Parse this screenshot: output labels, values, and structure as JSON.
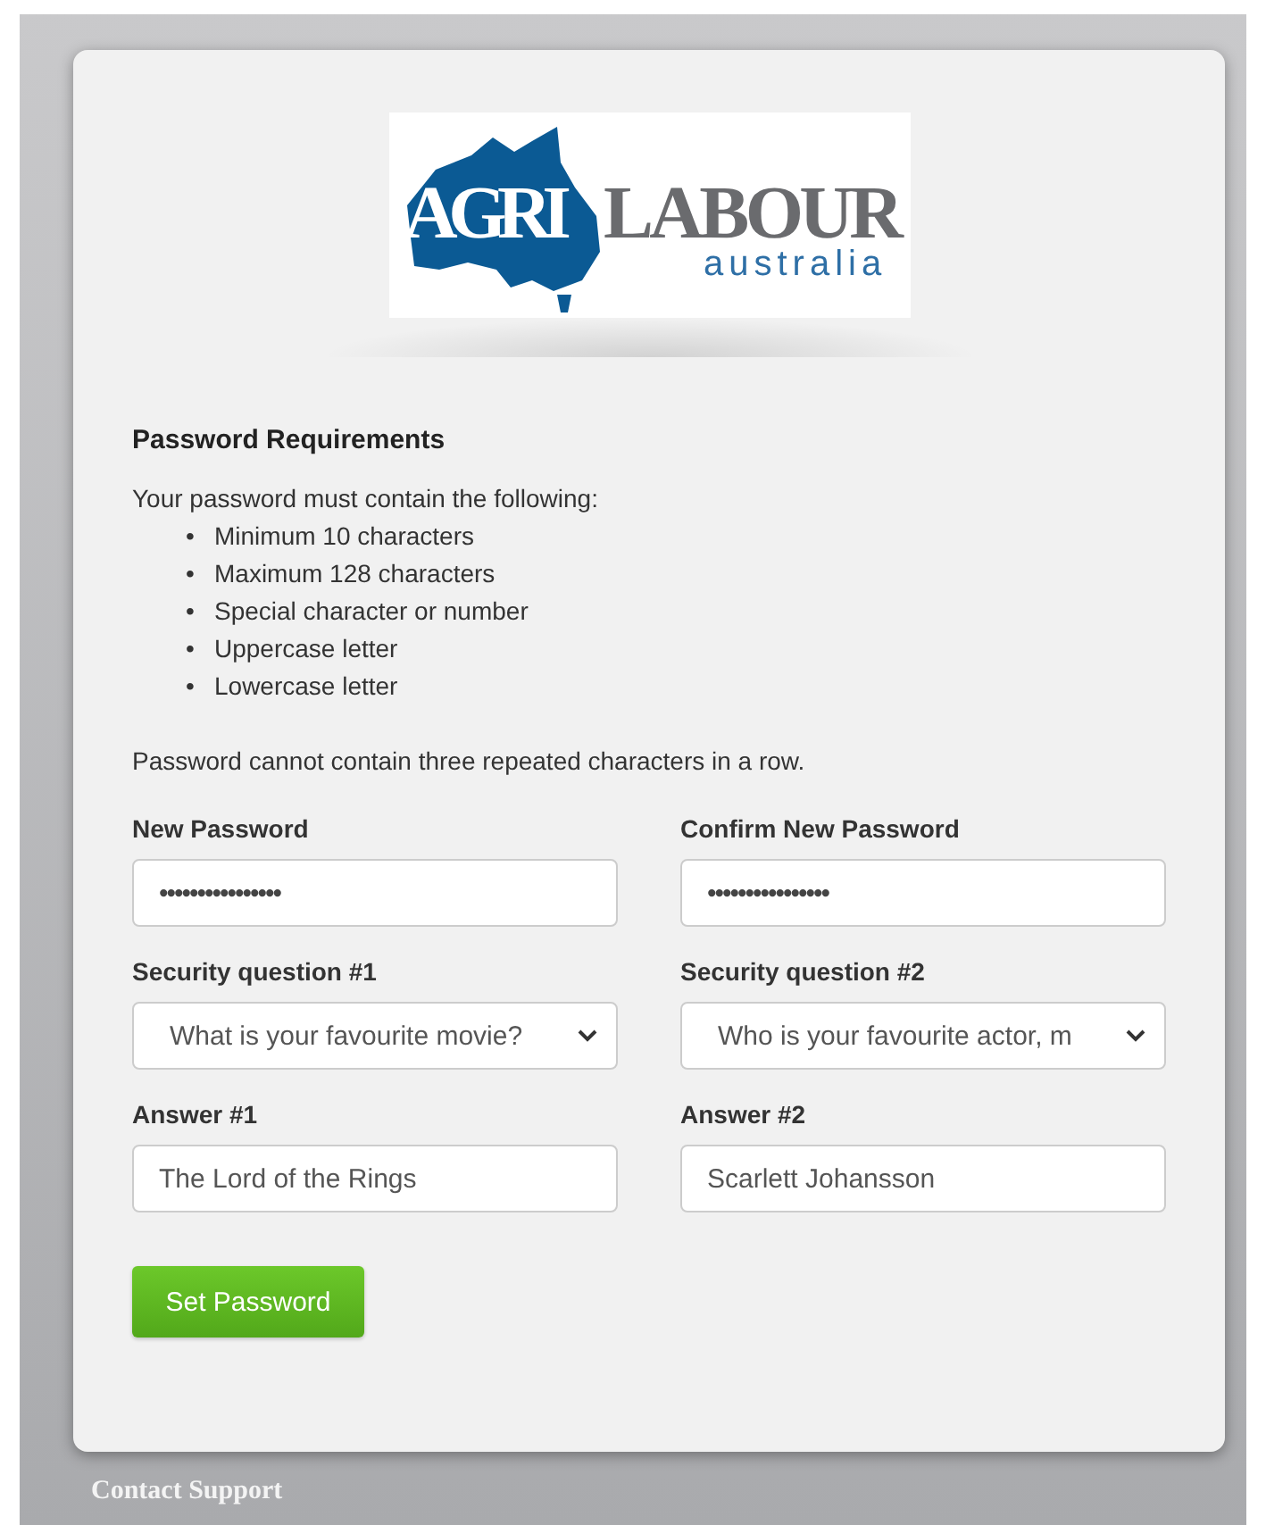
{
  "logo": {
    "word_1": "AGRI",
    "word_2": "LABOUR",
    "tagline": "australia"
  },
  "requirements": {
    "title": "Password Requirements",
    "intro": "Your password must contain the following:",
    "items": [
      {
        "marker": "•",
        "text": "Minimum 10 characters"
      },
      {
        "marker": "•",
        "text": "Maximum 128 characters"
      },
      {
        "marker": "•",
        "text": "Special character or number"
      },
      {
        "marker": "•",
        "text": "Uppercase letter"
      },
      {
        "marker": "•",
        "text": "Lowercase letter"
      }
    ],
    "note": "Password cannot contain three repeated characters in a row."
  },
  "fields": [
    {
      "kind": "password",
      "label": "New Password",
      "value": "••••••••••••••••"
    },
    {
      "kind": "password",
      "label": "Confirm New Password",
      "value": "••••••••••••••••"
    },
    {
      "kind": "select",
      "label": "Security question #1",
      "value": "What is your favourite movie?"
    },
    {
      "kind": "select",
      "label": "Security question #2",
      "value": "Who is your favourite actor, m"
    },
    {
      "kind": "text",
      "label": "Answer #1",
      "value": "The Lord of the Rings"
    },
    {
      "kind": "text",
      "label": "Answer #2",
      "value": "Scarlett Johansson"
    }
  ],
  "submit_button": "Set Password",
  "footer_link": "Contact Support"
}
